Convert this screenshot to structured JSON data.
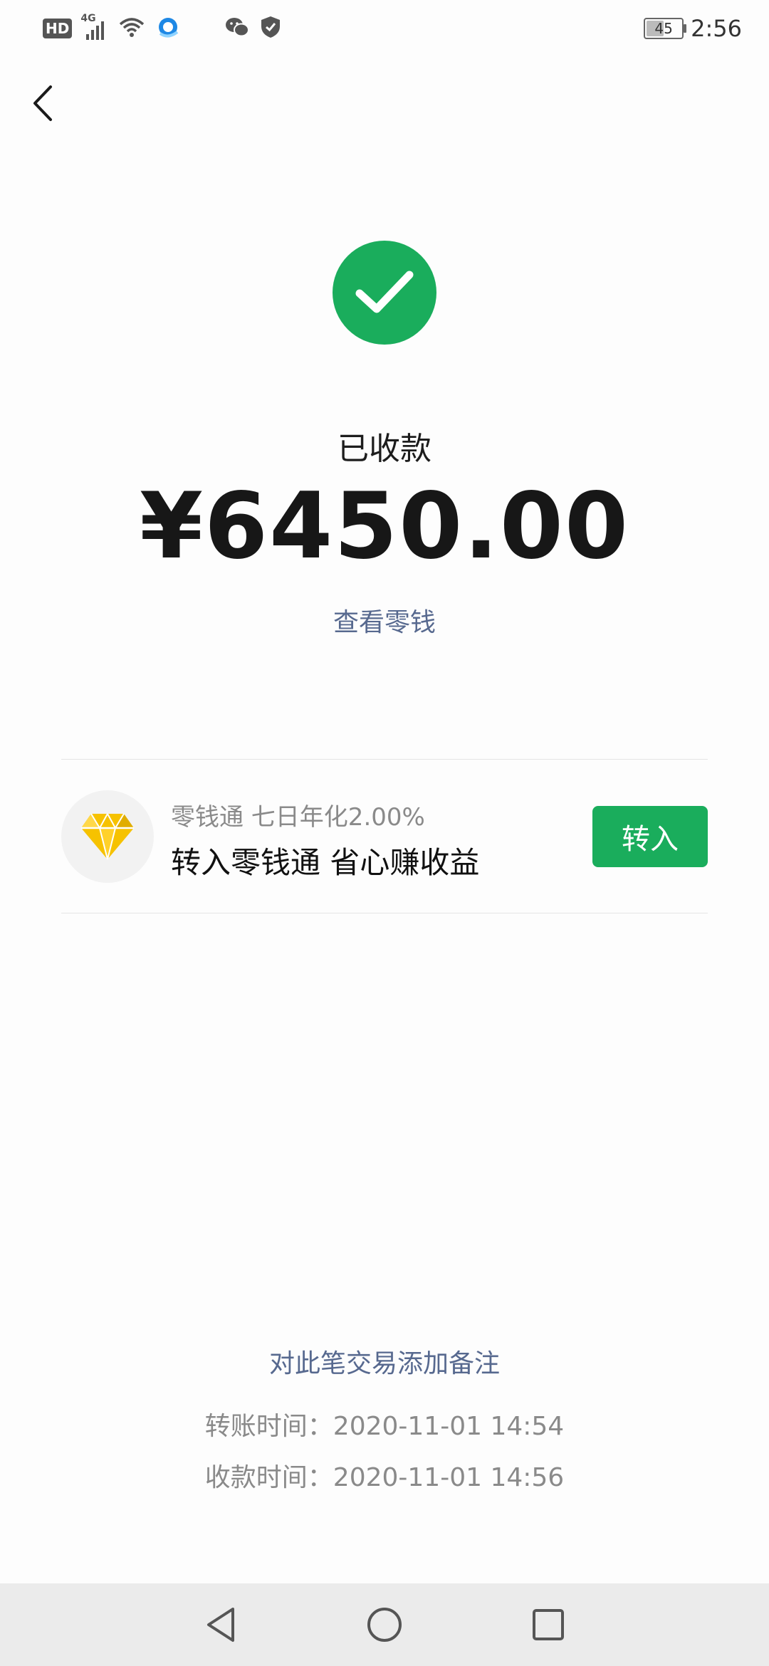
{
  "status_bar": {
    "hd": "HD",
    "network": "4G",
    "battery": "45",
    "time": "2:56"
  },
  "receipt": {
    "status": "已收款",
    "amount": "¥6450.00",
    "view_balance": "查看零钱"
  },
  "promo": {
    "subtitle": "零钱通 七日年化2.00%",
    "title": "转入零钱通 省心赚收益",
    "button": "转入"
  },
  "footer": {
    "add_note": "对此笔交易添加备注",
    "transfer_time": "转账时间：2020-11-01 14:54",
    "receive_time": "收款时间：2020-11-01 14:56"
  },
  "colors": {
    "accent_green": "#1aad5c",
    "link_blue": "#57698f",
    "diamond_yellow": "#f6c200"
  },
  "icons": {
    "back": "chevron-left-icon",
    "success": "checkmark-icon",
    "promo": "diamond-icon",
    "nav_back": "triangle-back-icon",
    "nav_home": "circle-home-icon",
    "nav_recent": "square-recent-icon"
  }
}
